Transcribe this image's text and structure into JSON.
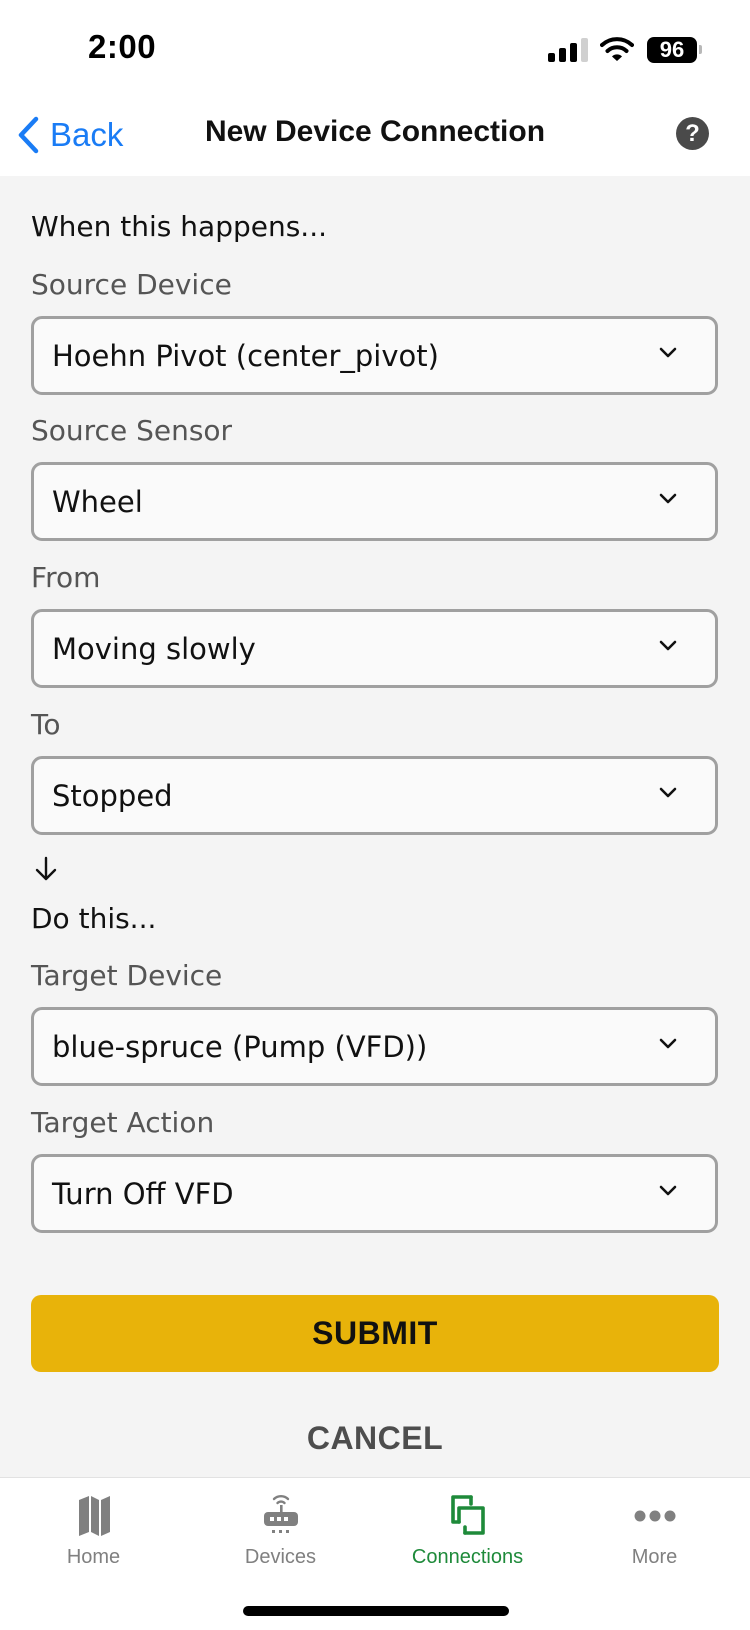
{
  "status_bar": {
    "time": "2:00",
    "battery": "96",
    "icons": [
      "cellular-signal-icon",
      "wifi-icon",
      "battery-icon"
    ]
  },
  "nav": {
    "back_label": "Back",
    "title": "New Device Connection",
    "help_label": "?"
  },
  "form": {
    "trigger_heading": "When this happens...",
    "action_heading": "Do this...",
    "fields": [
      {
        "label": "Source Device",
        "value": "Hoehn Pivot (center_pivot)"
      },
      {
        "label": "Source Sensor",
        "value": "Wheel"
      },
      {
        "label": "From",
        "value": "Moving slowly"
      },
      {
        "label": "To",
        "value": "Stopped"
      },
      {
        "label": "Target Device",
        "value": "blue-spruce (Pump (VFD))"
      },
      {
        "label": "Target Action",
        "value": "Turn Off VFD"
      }
    ],
    "submit_label": "SUBMIT",
    "cancel_label": "CANCEL"
  },
  "tab_bar": {
    "tabs": [
      {
        "label": "Home",
        "icon": "map-icon",
        "active": false
      },
      {
        "label": "Devices",
        "icon": "router-icon",
        "active": false
      },
      {
        "label": "Connections",
        "icon": "connections-icon",
        "active": true
      },
      {
        "label": "More",
        "icon": "more-dots-icon",
        "active": false
      }
    ]
  },
  "colors": {
    "accent_blue": "#1a7cf5",
    "submit_yellow": "#e8b30a",
    "active_green": "#1e8a3a",
    "inactive_gray": "#808080"
  }
}
